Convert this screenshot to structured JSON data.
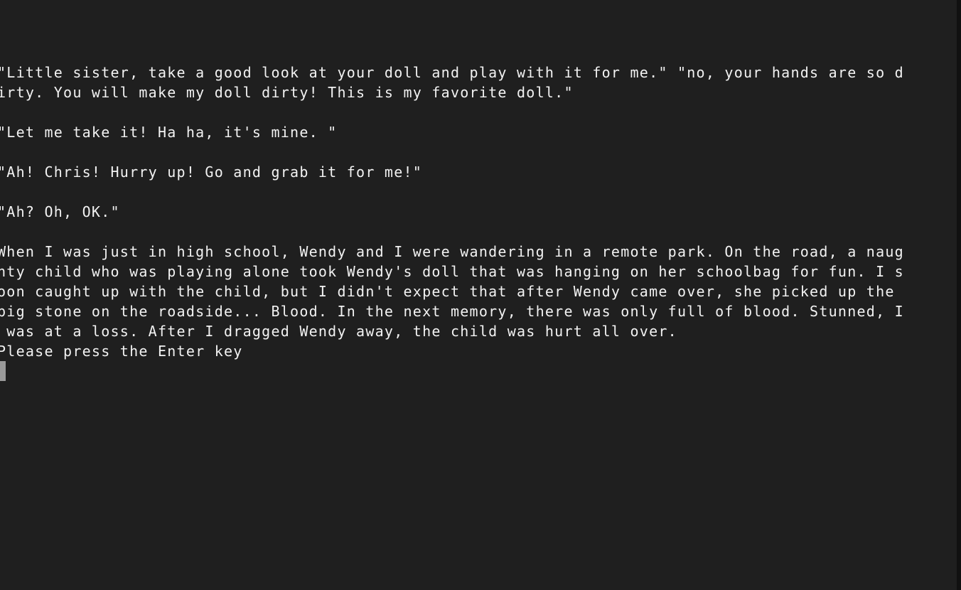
{
  "terminal": {
    "lines": [
      "\"Little sister, take a good look at your doll and play with it for me.\" \"no, your hands are so d",
      "irty. You will make my doll dirty! This is my favorite doll.\"",
      "",
      "\"Let me take it! Ha ha, it's mine. \"",
      "",
      "\"Ah! Chris! Hurry up! Go and grab it for me!\"",
      "",
      "\"Ah? Oh, OK.\"",
      "",
      "When I was just in high school, Wendy and I were wandering in a remote park. On the road, a naug",
      "hty child who was playing alone took Wendy's doll that was hanging on her schoolbag for fun. I s",
      "oon caught up with the child, but I didn't expect that after Wendy came over, she picked up the",
      "big stone on the roadside... Blood. In the next memory, there was only full of blood. Stunned, I",
      " was at a loss. After I dragged Wendy away, the child was hurt all over.",
      "Please press the Enter key"
    ]
  }
}
